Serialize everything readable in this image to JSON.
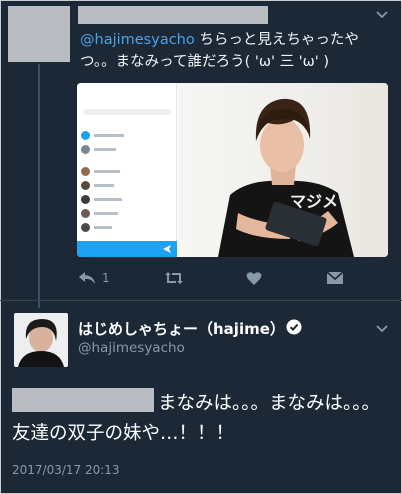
{
  "reply_tweet": {
    "mention": "@hajimesyacho",
    "text": " ちらっと見えちゃったやつ。。まなみって誰だろう( 'ω' 三 'ω' )",
    "actions": {
      "reply_icon": "reply-icon",
      "reply_count": "1",
      "retweet_icon": "retweet-icon",
      "like_icon": "heart-icon",
      "dm_icon": "envelope-icon"
    }
  },
  "main_tweet": {
    "display_name": "はじめしゃちょー（hajime）",
    "verified_icon": "verified-badge-icon",
    "handle": "@hajimesyacho",
    "text": "まなみは。。。まなみは。。。友達の双子の妹や…！！！",
    "timestamp": "2017/03/17 20:13"
  },
  "colors": {
    "background": "#1c2836",
    "mention": "#4aa3e8",
    "muted": "#8899a6",
    "redaction": "#b9bcc0"
  }
}
